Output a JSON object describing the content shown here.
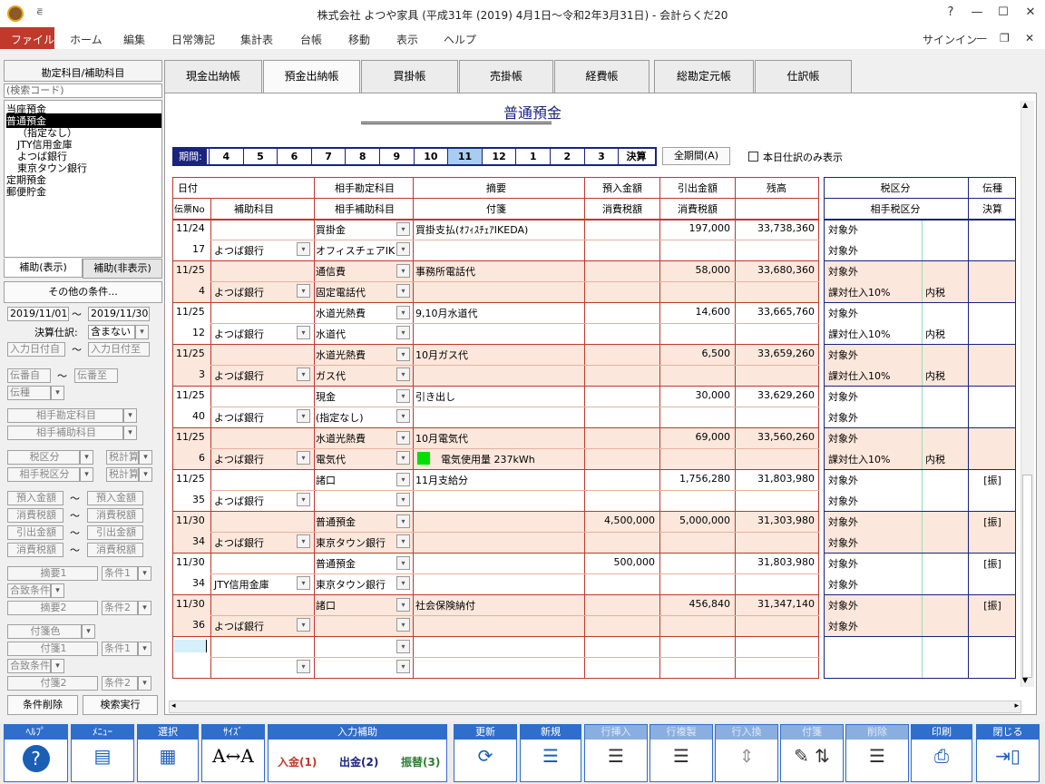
{
  "window": {
    "title": "株式会社 よつや家具 (平成31年 (2019) 4月1日～令和2年3月31日) - 会計らくだ20",
    "help": "?",
    "min": "—",
    "max": "☐",
    "close": "✕",
    "qa": "⋷"
  },
  "menu": {
    "file": "ファイル",
    "items": [
      "ホーム",
      "編集",
      "日常簿記",
      "集計表",
      "台帳",
      "移動",
      "表示",
      "ヘルプ"
    ],
    "signin": "サインイン"
  },
  "left": {
    "heading": "勘定科目/補助科目",
    "search_placeholder": "(検索コード)",
    "tree": [
      "当座預金",
      "普通預金",
      "（指定なし）",
      "JTY信用金庫",
      "よつば銀行",
      "東京タウン銀行",
      "定期預金",
      "郵便貯金"
    ],
    "tab_show": "補助(表示)",
    "tab_hide": "補助(非表示)",
    "other_conditions": "その他の条件...",
    "date_from": "2019/11/01",
    "date_sep": "〜",
    "date_to": "2019/11/30",
    "closing_label": "決算仕訳:",
    "closing_value": "含まない",
    "entry_from": "入力日付自",
    "entry_to": "入力日付至",
    "slip_from": "伝番自",
    "slip_to": "伝番至",
    "slip_type": "伝種",
    "counter_account": "相手勘定科目",
    "counter_sub": "相手補助科目",
    "tax_class": "税区分",
    "tax_calc": "税計算",
    "counter_tax": "相手税区分",
    "tax_calc2": "税計算",
    "deposit_amt": "預入金額",
    "deposit_tax": "消費税額",
    "withdraw_amt": "引出金額",
    "withdraw_tax": "消費税額",
    "memo1": "摘要1",
    "cond1": "条件1",
    "match": "合致条件",
    "memo2": "摘要2",
    "cond2": "条件2",
    "tag_color": "付箋色",
    "tag1": "付箋1",
    "tag_cond1": "条件1",
    "tag_match": "合致条件",
    "tag2": "付箋2",
    "tag_cond2": "条件2",
    "clear": "条件削除",
    "search": "検索実行"
  },
  "tabs": [
    "現金出納帳",
    "預金出納帳",
    "買掛帳",
    "売掛帳",
    "経費帳",
    "総勘定元帳",
    "仕訳帳"
  ],
  "ledger": {
    "title": "普通預金",
    "period_label": "期間:",
    "periods": [
      "4",
      "5",
      "6",
      "7",
      "8",
      "9",
      "10",
      "11",
      "12",
      "1",
      "2",
      "3",
      "決算"
    ],
    "active_period": "11",
    "all_period_btn": "全期間(A)",
    "today_only": "本日仕訳のみ表示",
    "headers": {
      "date": "日付",
      "slip": "伝票No",
      "sub": "補助科目",
      "counter": "相手勘定科目",
      "counter_sub": "相手補助科目",
      "memo": "摘要",
      "tag": "付箋",
      "deposit": "預入金額",
      "dep_tax": "消費税額",
      "withdraw": "引出金額",
      "wd_tax": "消費税額",
      "balance": "残高",
      "tax": "税区分",
      "ctax": "相手税区分",
      "type": "伝種",
      "closing": "決算"
    },
    "rows": [
      {
        "date": "11/24",
        "no": "17",
        "sub": "よつば銀行",
        "acct": "買掛金",
        "csub": "オフィスチェアIKE",
        "memo": "買掛支払(ｵﾌｨｽﾁｪｱIKEDA)",
        "tag": "",
        "dep": "",
        "wd": "197,000",
        "bal": "33,738,360",
        "tax": "対象外",
        "ctax": "対象外",
        "ctaxin": "",
        "type": ""
      },
      {
        "date": "11/25",
        "no": "4",
        "sub": "よつば銀行",
        "acct": "通信費",
        "csub": "固定電話代",
        "memo": "事務所電話代",
        "tag": "",
        "dep": "",
        "wd": "58,000",
        "bal": "33,680,360",
        "tax": "対象外",
        "ctax": "課対仕入10%",
        "ctaxin": "内税",
        "type": ""
      },
      {
        "date": "11/25",
        "no": "12",
        "sub": "よつば銀行",
        "acct": "水道光熱費",
        "csub": "水道代",
        "memo": "9,10月水道代",
        "tag": "",
        "dep": "",
        "wd": "14,600",
        "bal": "33,665,760",
        "tax": "対象外",
        "ctax": "課対仕入10%",
        "ctaxin": "内税",
        "type": ""
      },
      {
        "date": "11/25",
        "no": "3",
        "sub": "よつば銀行",
        "acct": "水道光熱費",
        "csub": "ガス代",
        "memo": "10月ガス代",
        "tag": "",
        "dep": "",
        "wd": "6,500",
        "bal": "33,659,260",
        "tax": "対象外",
        "ctax": "課対仕入10%",
        "ctaxin": "内税",
        "type": ""
      },
      {
        "date": "11/25",
        "no": "40",
        "sub": "よつば銀行",
        "acct": "現金",
        "csub": "(指定なし)",
        "memo": "引き出し",
        "tag": "",
        "dep": "",
        "wd": "30,000",
        "bal": "33,629,260",
        "tax": "対象外",
        "ctax": "対象外",
        "ctaxin": "",
        "type": ""
      },
      {
        "date": "11/25",
        "no": "6",
        "sub": "よつば銀行",
        "acct": "水道光熱費",
        "csub": "電気代",
        "memo": "10月電気代",
        "tag": "電気使用量 237kWh",
        "dep": "",
        "wd": "69,000",
        "bal": "33,560,260",
        "tax": "対象外",
        "ctax": "課対仕入10%",
        "ctaxin": "内税",
        "type": ""
      },
      {
        "date": "11/25",
        "no": "35",
        "sub": "よつば銀行",
        "acct": "諸口",
        "csub": "",
        "memo": "11月支給分",
        "tag": "",
        "dep": "",
        "wd": "1,756,280",
        "bal": "31,803,980",
        "tax": "対象外",
        "ctax": "対象外",
        "ctaxin": "",
        "type": "[振]"
      },
      {
        "date": "11/30",
        "no": "34",
        "sub": "よつば銀行",
        "acct": "普通預金",
        "csub": "東京タウン銀行",
        "memo": "",
        "tag": "",
        "dep": "4,500,000",
        "wd": "5,000,000",
        "bal": "31,303,980",
        "tax": "対象外",
        "ctax": "対象外",
        "ctaxin": "",
        "type": "[振]"
      },
      {
        "date": "11/30",
        "no": "34",
        "sub": "JTY信用金庫",
        "acct": "普通預金",
        "csub": "東京タウン銀行",
        "memo": "",
        "tag": "",
        "dep": "500,000",
        "wd": "",
        "bal": "31,803,980",
        "tax": "対象外",
        "ctax": "対象外",
        "ctaxin": "",
        "type": "[振]"
      },
      {
        "date": "11/30",
        "no": "36",
        "sub": "よつば銀行",
        "acct": "諸口",
        "csub": "",
        "memo": "社会保険納付",
        "tag": "",
        "dep": "",
        "wd": "456,840",
        "bal": "31,347,140",
        "tax": "対象外",
        "ctax": "対象外",
        "ctaxin": "",
        "type": "[振]"
      }
    ]
  },
  "toolbar": {
    "help": "ﾍﾙﾌﾟ",
    "menu": "ﾒﾆｭｰ",
    "select": "選択",
    "size": "ｻｲｽﾞ",
    "input_aid": "入力補助",
    "deposit": "入金(1)",
    "withdraw": "出金(2)",
    "transfer": "振替(3)",
    "update": "更新",
    "new": "新規",
    "row_insert": "行挿入",
    "row_copy": "行複製",
    "row_swap": "行入換",
    "tag": "付箋",
    "delete": "削除",
    "print": "印刷",
    "close": "閉じる"
  },
  "colors": {
    "accent": "#2f6ecb",
    "file_menu": "#c0392b",
    "row_alt": "#fbe7dc",
    "grid": "#c0392b",
    "period_border": "#1a237e",
    "active_period": "#a9cdf0"
  }
}
